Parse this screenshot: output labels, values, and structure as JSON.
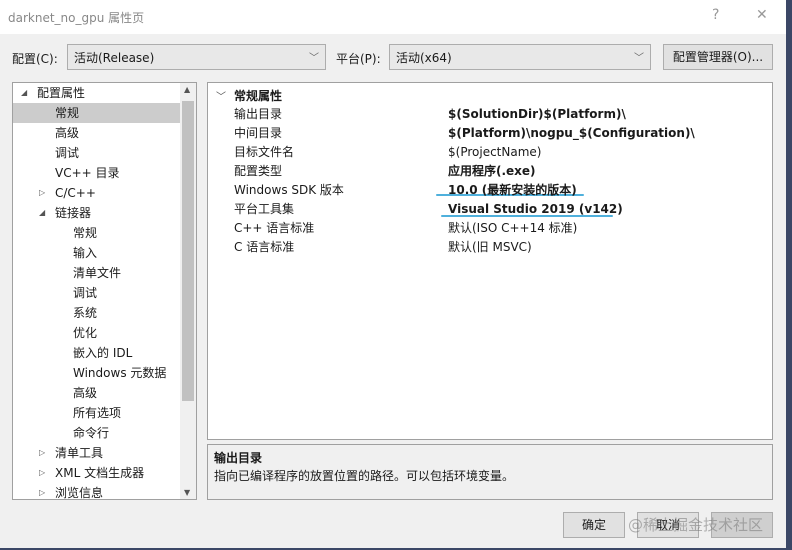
{
  "window": {
    "title": "darknet_no_gpu 属性页",
    "help": "?",
    "close": "✕"
  },
  "toolbar": {
    "config_label": "配置(C):",
    "config_value": "活动(Release)",
    "platform_label": "平台(P):",
    "platform_value": "活动(x64)",
    "config_manager": "配置管理器(O)..."
  },
  "tree": [
    {
      "label": "配置属性",
      "level": 0,
      "exp": "◢"
    },
    {
      "label": "常规",
      "level": 1,
      "selected": true
    },
    {
      "label": "高级",
      "level": 1
    },
    {
      "label": "调试",
      "level": 1
    },
    {
      "label": "VC++ 目录",
      "level": 1
    },
    {
      "label": "C/C++",
      "level": 1,
      "exp": "▷"
    },
    {
      "label": "链接器",
      "level": 1,
      "exp": "◢"
    },
    {
      "label": "常规",
      "level": 2
    },
    {
      "label": "输入",
      "level": 2
    },
    {
      "label": "清单文件",
      "level": 2
    },
    {
      "label": "调试",
      "level": 2
    },
    {
      "label": "系统",
      "level": 2
    },
    {
      "label": "优化",
      "level": 2
    },
    {
      "label": "嵌入的 IDL",
      "level": 2
    },
    {
      "label": "Windows 元数据",
      "level": 2
    },
    {
      "label": "高级",
      "level": 2
    },
    {
      "label": "所有选项",
      "level": 2
    },
    {
      "label": "命令行",
      "level": 2
    },
    {
      "label": "清单工具",
      "level": 1,
      "exp": "▷"
    },
    {
      "label": "XML 文档生成器",
      "level": 1,
      "exp": "▷"
    },
    {
      "label": "浏览信息",
      "level": 1,
      "exp": "▷"
    }
  ],
  "grid": {
    "section": "常规属性",
    "rows": [
      {
        "k": "输出目录",
        "v": "$(SolutionDir)$(Platform)\\",
        "bold": true
      },
      {
        "k": "中间目录",
        "v": "$(Platform)\\nogpu_$(Configuration)\\",
        "bold": true
      },
      {
        "k": "目标文件名",
        "v": "$(ProjectName)",
        "bold": false
      },
      {
        "k": "配置类型",
        "v": "应用程序(.exe)",
        "bold": true
      },
      {
        "k": "Windows SDK 版本",
        "v": "10.0 (最新安装的版本)",
        "bold": true
      },
      {
        "k": "平台工具集",
        "v": "Visual Studio 2019 (v142)",
        "bold": true
      },
      {
        "k": "C++ 语言标准",
        "v": "默认(ISO C++14 标准)",
        "bold": false
      },
      {
        "k": "C 语言标准",
        "v": "默认(旧 MSVC)",
        "bold": false
      }
    ]
  },
  "description": {
    "title": "输出目录",
    "text": "指向已编译程序的放置位置的路径。可以包括环境变量。"
  },
  "buttons": {
    "ok": "确定",
    "cancel": "取消"
  },
  "watermark": "@稀土掘金技术社区"
}
